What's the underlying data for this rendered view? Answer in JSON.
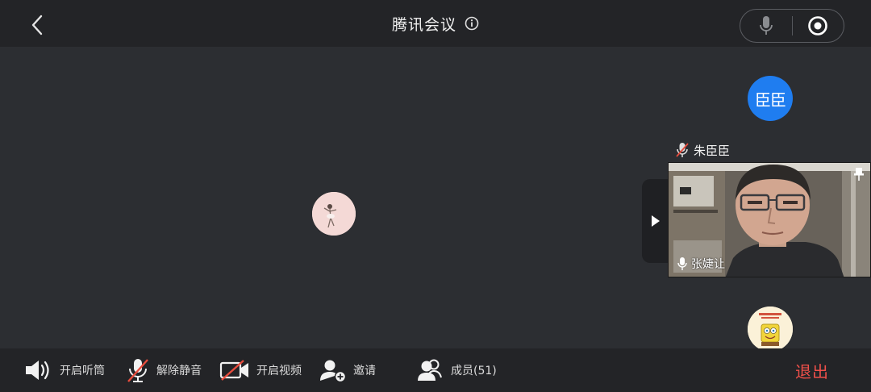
{
  "header": {
    "title": "腾讯会议"
  },
  "participants": {
    "avatar_blue_text": "臣臣",
    "muted_name": "朱臣臣",
    "video_tile_name": "张婕让"
  },
  "toolbar": {
    "speaker_label": "开启听筒",
    "unmute_label": "解除静音",
    "video_label": "开启视频",
    "invite_label": "邀请",
    "members_label": "成员(51)",
    "exit_label": "退出"
  },
  "colors": {
    "accent_blue": "#1f7df0",
    "exit_red": "#f0504a",
    "muted_red": "#e84c3d"
  }
}
